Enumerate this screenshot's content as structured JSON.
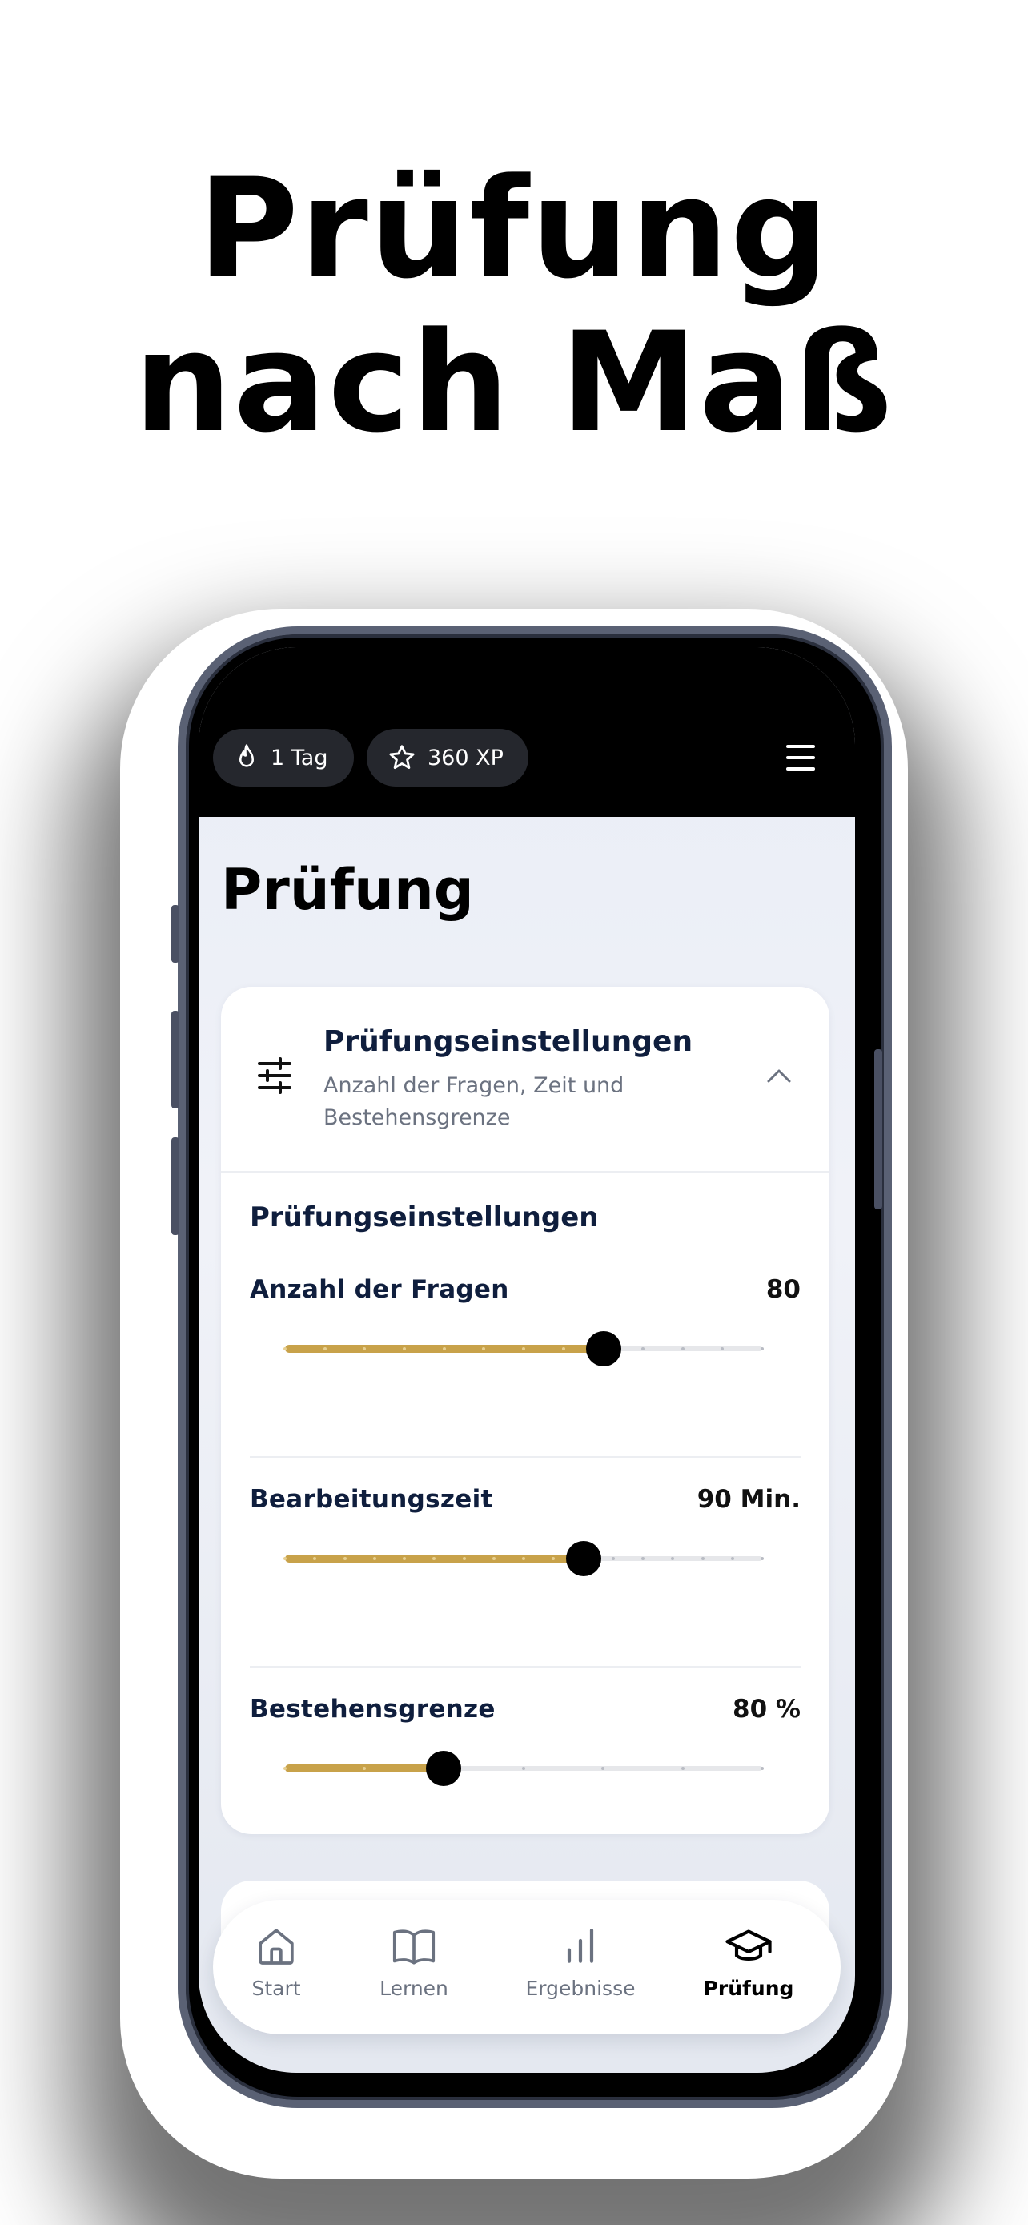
{
  "headline": {
    "line1": "Prüfung",
    "line2": "nach Maß"
  },
  "status": {
    "streak": "1 Tag",
    "xp": "360 XP"
  },
  "page_title": "Prüfung",
  "settings_card": {
    "title": "Prüfungseinstellungen",
    "subtitle": "Anzahl der Fragen, Zeit und Bestehensgrenze",
    "section_title": "Prüfungseinstellungen",
    "rows": [
      {
        "label": "Anzahl der Fragen",
        "value": "80",
        "fraction": 0.667,
        "steps": 12
      },
      {
        "label": "Bearbeitungszeit",
        "value": "90 Min.",
        "fraction": 0.625,
        "steps": 16
      },
      {
        "label": "Bestehensgrenze",
        "value": "80 %",
        "fraction": 0.333,
        "steps": 6
      }
    ]
  },
  "tabs": [
    {
      "label": "Start",
      "icon": "home-icon",
      "active": false
    },
    {
      "label": "Lernen",
      "icon": "book-icon",
      "active": false
    },
    {
      "label": "Ergebnisse",
      "icon": "bar-chart-icon",
      "active": false
    },
    {
      "label": "Prüfung",
      "icon": "graduation-cap-icon",
      "active": true
    }
  ],
  "colors": {
    "accent": "#c8a24a",
    "title": "#0f1e3d",
    "knob": "#000000"
  }
}
